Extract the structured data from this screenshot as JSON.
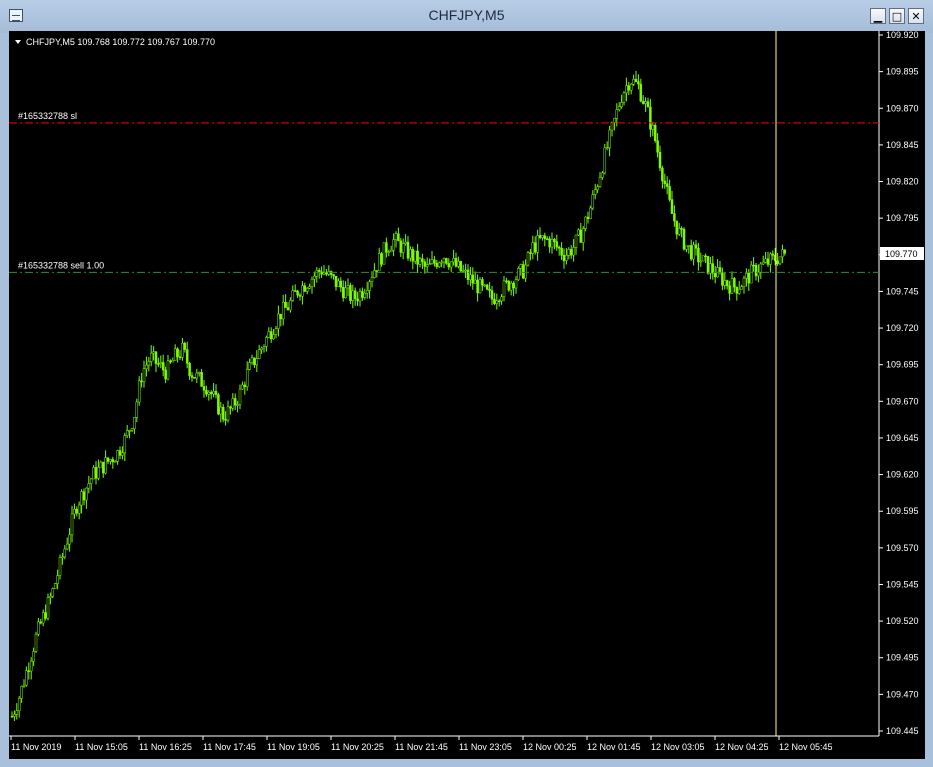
{
  "window": {
    "title": "CHFJPY,M5"
  },
  "controls": {
    "minimize": "▁",
    "maximize": "□",
    "close": "✕"
  },
  "chart": {
    "header": "CHFJPY,M5  109.768 109.772 109.767 109.770",
    "current_price": "109.770",
    "sl_label": "#165332788 sl",
    "order_label": "#165332788 sell 1.00",
    "sl_price": 109.86,
    "order_price": 109.758
  },
  "colors": {
    "background": "#000000",
    "candles": "#7cfc00",
    "sl_line": "#ff0000",
    "order_line": "#2e8b2e",
    "cursor_line": "#ffff80",
    "grid_text": "#ffffff"
  },
  "chart_data": {
    "type": "candlestick",
    "title": "CHFJPY,M5",
    "ylim": [
      109.445,
      109.92
    ],
    "y_ticks": [
      "109.920",
      "109.895",
      "109.870",
      "109.845",
      "109.820",
      "109.795",
      "109.770",
      "109.745",
      "109.720",
      "109.695",
      "109.670",
      "109.645",
      "109.620",
      "109.595",
      "109.570",
      "109.545",
      "109.520",
      "109.495",
      "109.470",
      "109.445"
    ],
    "x_ticks": [
      "11 Nov 2019",
      "11 Nov 15:05",
      "11 Nov 16:25",
      "11 Nov 17:45",
      "11 Nov 19:05",
      "11 Nov 20:25",
      "11 Nov 21:45",
      "11 Nov 23:05",
      "12 Nov 00:25",
      "12 Nov 01:45",
      "12 Nov 03:05",
      "12 Nov 04:25",
      "12 Nov 05:45"
    ],
    "close_path": [
      109.455,
      109.47,
      109.49,
      109.51,
      109.525,
      109.54,
      109.56,
      109.58,
      109.6,
      109.61,
      109.62,
      109.625,
      109.63,
      109.635,
      109.645,
      109.66,
      109.69,
      109.7,
      109.695,
      109.69,
      109.7,
      109.705,
      109.69,
      109.685,
      109.68,
      109.67,
      109.66,
      109.665,
      109.675,
      109.69,
      109.7,
      109.71,
      109.72,
      109.73,
      109.735,
      109.745,
      109.75,
      109.755,
      109.76,
      109.755,
      109.75,
      109.745,
      109.74,
      109.745,
      109.755,
      109.765,
      109.775,
      109.78,
      109.775,
      109.77,
      109.765,
      109.76,
      109.765,
      109.77,
      109.765,
      109.76,
      109.755,
      109.75,
      109.745,
      109.74,
      109.745,
      109.75,
      109.755,
      109.76,
      109.775,
      109.78,
      109.78,
      109.775,
      109.77,
      109.775,
      109.785,
      109.8,
      109.82,
      109.84,
      109.86,
      109.88,
      109.89,
      109.885,
      109.87,
      109.85,
      109.825,
      109.8,
      109.785,
      109.775,
      109.77,
      109.765,
      109.76,
      109.755,
      109.75,
      109.748,
      109.752,
      109.758,
      109.762,
      109.765,
      109.768,
      109.77
    ]
  }
}
